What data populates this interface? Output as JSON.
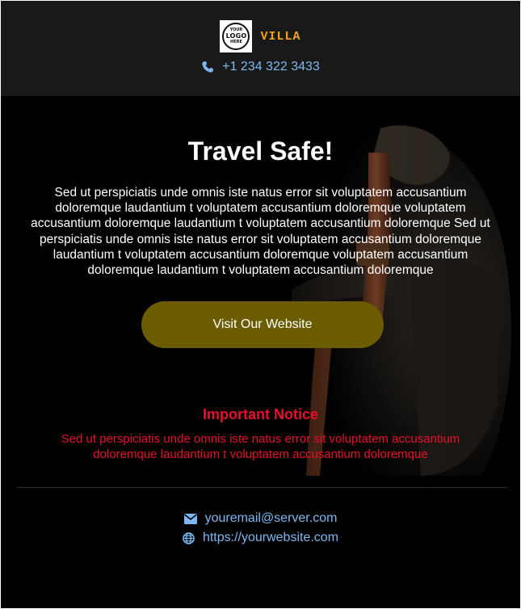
{
  "header": {
    "logo": {
      "text_top": "YOUR",
      "text_middle": "LOGO",
      "text_bottom": "HERE"
    },
    "brand_name": "VILLA",
    "phone": "+1 234 322 3433",
    "phone_icon": "phone-icon"
  },
  "hero": {
    "title": "Travel Safe!",
    "body": "Sed ut perspiciatis unde omnis iste natus error sit voluptatem accusantium doloremque laudantium t voluptatem accusantium doloremque voluptatem accusantium doloremque laudantium t voluptatem accusantium doloremque Sed ut perspiciatis unde omnis iste natus error sit voluptatem accusantium doloremque laudantium t voluptatem accusantium doloremque voluptatem accusantium doloremque laudantium t voluptatem accusantium doloremque",
    "cta_label": "Visit Our Website"
  },
  "notice": {
    "title": "Important Notice",
    "text": "Sed ut perspiciatis unde omnis iste natus error sit voluptatem accusantium doloremque laudantium t voluptatem accusantium doloremque"
  },
  "contact": {
    "email": "youremail@server.com",
    "email_icon": "envelope-icon",
    "website": "https://yourwebsite.com",
    "website_icon": "globe-icon"
  },
  "colors": {
    "background": "#000000",
    "header_background": "#191919",
    "brand_accent": "#f2a413",
    "link_blue": "#7db8f0",
    "cta_background": "#6b5c00",
    "notice_red": "#e8102a"
  }
}
